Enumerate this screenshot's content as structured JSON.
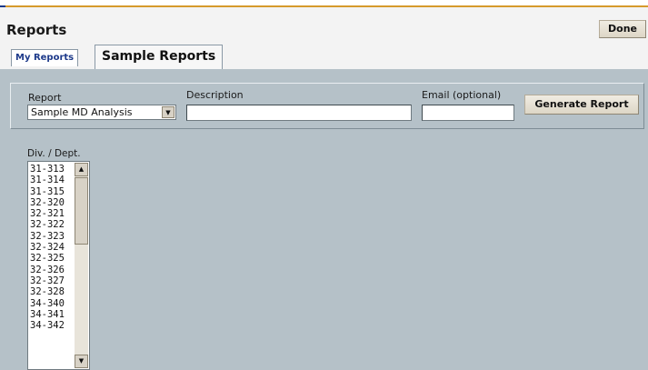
{
  "header": {
    "title": "Reports",
    "done_label": "Done"
  },
  "tabs": [
    {
      "label": "My Reports",
      "active": false
    },
    {
      "label": "Sample Reports",
      "active": true
    }
  ],
  "form": {
    "report_label": "Report",
    "report_selected": "Sample MD Analysis",
    "description_label": "Description",
    "description_value": "",
    "email_label": "Email (optional)",
    "email_value": "",
    "generate_label": "Generate Report"
  },
  "divisions": {
    "label": "Div. / Dept.",
    "items": [
      "31-313",
      "31-314",
      "31-315",
      "32-320",
      "32-321",
      "32-322",
      "32-323",
      "32-324",
      "32-325",
      "32-326",
      "32-327",
      "32-328",
      "34-340",
      "34-341",
      "34-342"
    ]
  },
  "colors": {
    "panel_bg": "#b5c1c8",
    "accent_rule": "#d69a2c",
    "tab_link": "#1d3a8a"
  }
}
